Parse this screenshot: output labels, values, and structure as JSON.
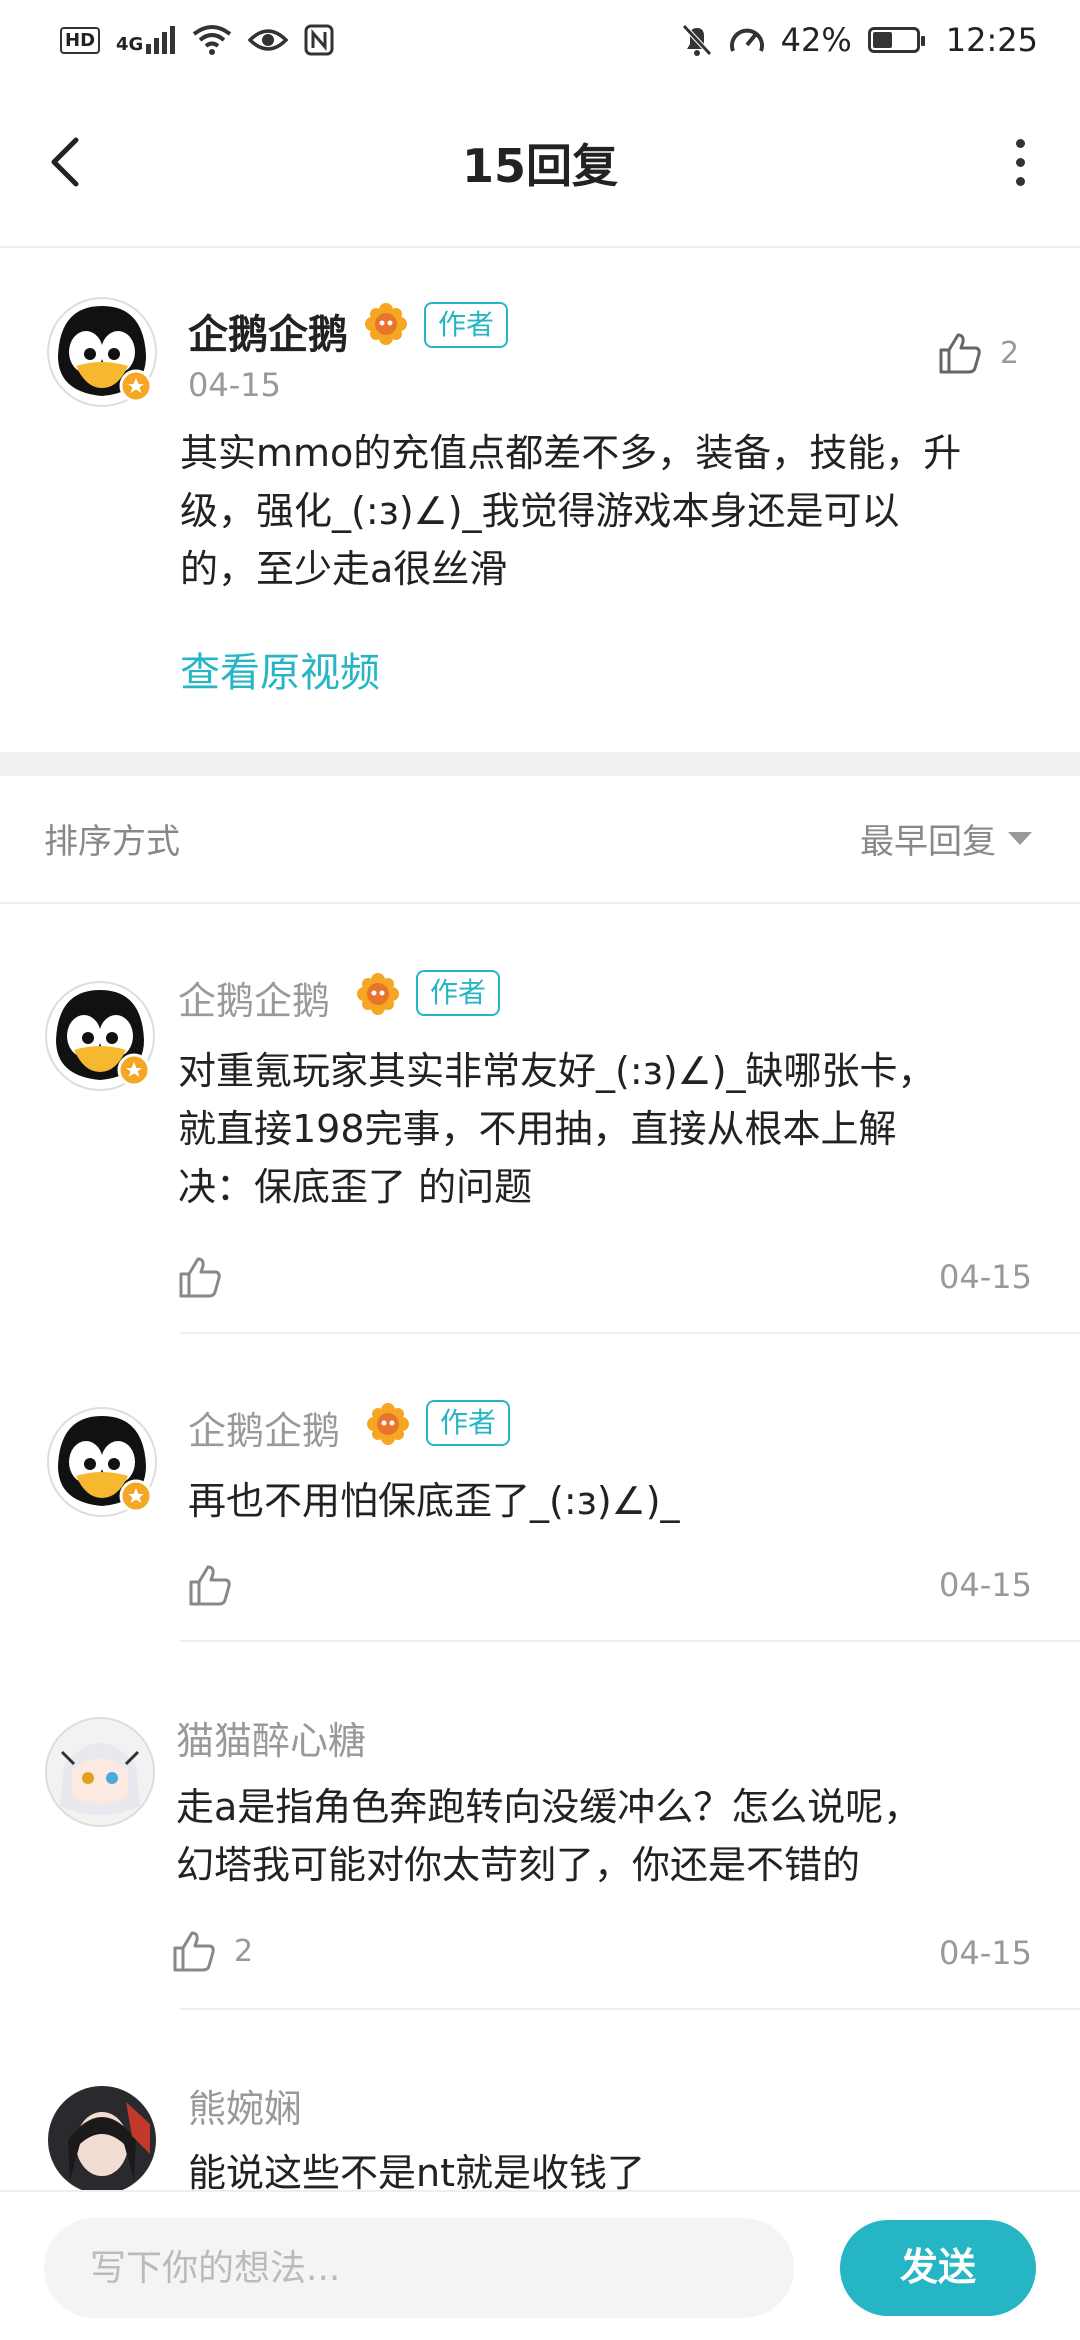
{
  "status": {
    "percent": "42%",
    "time": "12:25",
    "net": "4G"
  },
  "header": {
    "title": "15回复"
  },
  "main_post": {
    "author": "企鹅企鹅",
    "tag": "作者",
    "date": "04-15",
    "likes": "2",
    "lines": [
      "其实mmo的充值点都差不多，装备，技能，升",
      "级，强化_(:з)∠)_我觉得游戏本身还是可以",
      "的，至少走a很丝滑"
    ],
    "view_original": "查看原视频"
  },
  "sort": {
    "label": "排序方式",
    "value": "最早回复"
  },
  "replies": [
    {
      "author": "企鹅企鹅",
      "tag": "作者",
      "lines": [
        "对重氪玩家其实非常友好_(:з)∠)_缺哪张卡，",
        "就直接198完事，不用抽，直接从根本上解",
        "决：保底歪了 的问题"
      ],
      "likes": "",
      "date": "04-15"
    },
    {
      "author": "企鹅企鹅",
      "tag": "作者",
      "lines": [
        "再也不用怕保底歪了_(:з)∠)_"
      ],
      "likes": "",
      "date": "04-15"
    },
    {
      "author": "猫猫醉心糖",
      "lines": [
        "走a是指角色奔跑转向没缓冲么？怎么说呢，",
        "幻塔我可能对你太苛刻了，你还是不错的"
      ],
      "likes": "2",
      "date": "04-15"
    },
    {
      "author": "熊婉娴",
      "lines": [
        "能说这些不是nt就是收钱了"
      ]
    }
  ],
  "composer": {
    "placeholder": "写下你的想法...",
    "send": "发送"
  },
  "colors": {
    "accent": "#26b5c4"
  }
}
